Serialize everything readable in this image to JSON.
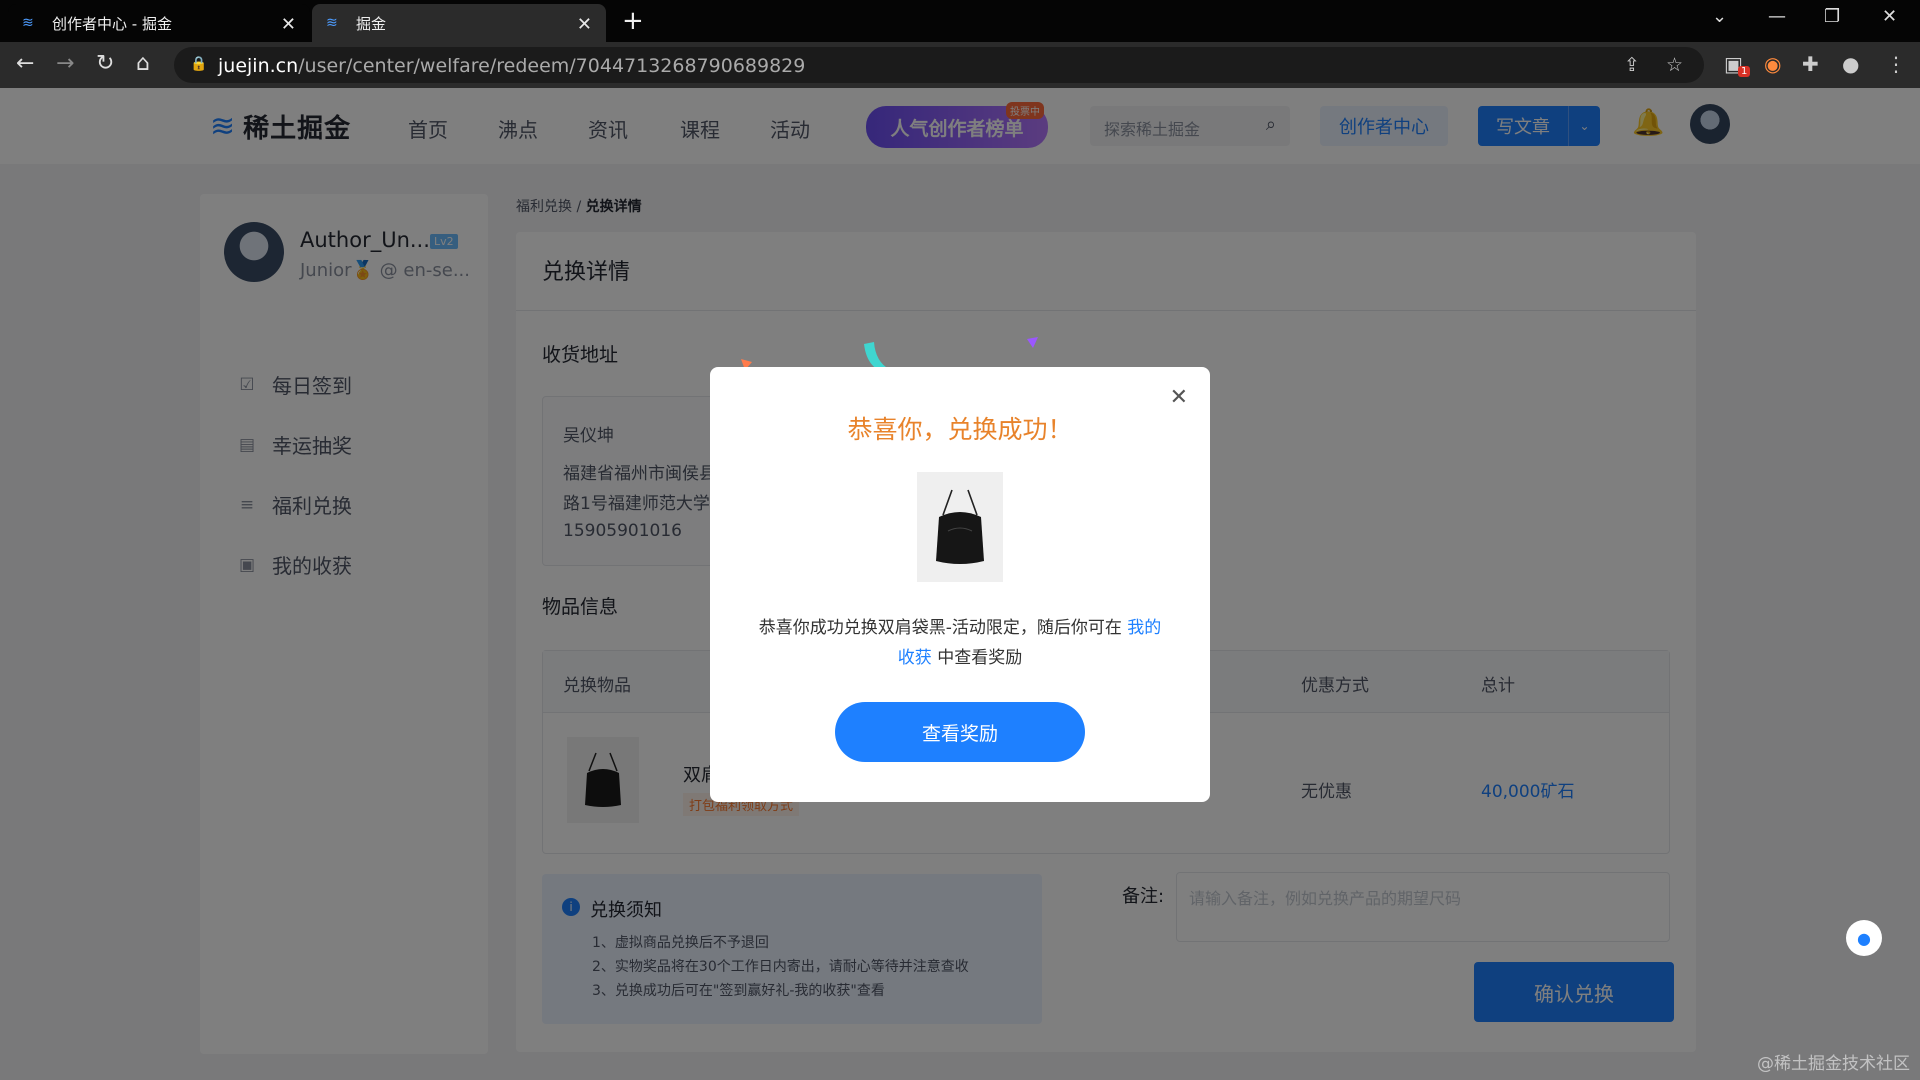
{
  "browser": {
    "tabs": [
      {
        "title": "创作者中心 - 掘金",
        "active": false
      },
      {
        "title": "掘金",
        "active": true
      }
    ],
    "url_host": "juejin.cn",
    "url_path": "/user/center/welfare/redeem/7044713268790689829",
    "extension_badge": "1"
  },
  "header": {
    "logo_text": "稀土掘金",
    "nav": [
      "首页",
      "沸点",
      "资讯",
      "课程",
      "活动"
    ],
    "promo_text": "人气创作者榜单",
    "promo_tag": "投票中",
    "search_placeholder": "探索稀土掘金",
    "creator_center": "创作者中心",
    "write_article": "写文章"
  },
  "sidebar": {
    "user_name": "Author_Un...",
    "level": "Lv2",
    "user_sub": "Junior🏅 @ en-se...",
    "items": [
      {
        "label": "每日签到",
        "icon": "calendar-check-icon"
      },
      {
        "label": "幸运抽奖",
        "icon": "gift-icon"
      },
      {
        "label": "福利兑换",
        "icon": "coins-icon"
      },
      {
        "label": "我的收获",
        "icon": "bag-icon"
      }
    ]
  },
  "breadcrumb": {
    "parent": "福利兑换",
    "separator": "/",
    "current": "兑换详情"
  },
  "main": {
    "title": "兑换详情",
    "address_section": "收货地址",
    "address": {
      "name": "吴仪坤",
      "line1": "福建省福州市闽侯县",
      "line2": "路1号福建师范大学",
      "phone": "15905901016"
    },
    "goods_section": "物品信息",
    "goods_headers": {
      "item": "兑换物品",
      "discount": "优惠方式",
      "total": "总计"
    },
    "goods_row": {
      "name": "双肩",
      "tag": "打包福利领取方式",
      "discount": "无优惠",
      "total": "40,000矿石"
    },
    "notice": {
      "title": "兑换须知",
      "lines": [
        "1、虚拟商品兑换后不予退回",
        "2、实物奖品将在30个工作日内寄出，请耐心等待并注意查收",
        "3、兑换成功后可在\"签到赢好礼-我的收获\"查看"
      ]
    },
    "remark_label": "备注:",
    "remark_placeholder": "请输入备注，例如兑换产品的期望尺码",
    "confirm_label": "确认兑换"
  },
  "modal": {
    "title": "恭喜你，兑换成功！",
    "message_prefix": "恭喜你成功兑换双肩袋黑-活动限定，随后你可在 ",
    "message_link": "我的收获",
    "message_suffix": " 中查看奖励",
    "button": "查看奖励"
  },
  "watermark": "@稀土掘金技术社区",
  "colors": {
    "brand": "#1e80ff",
    "modal_title": "#e8832b",
    "price": "#1e80ff"
  }
}
